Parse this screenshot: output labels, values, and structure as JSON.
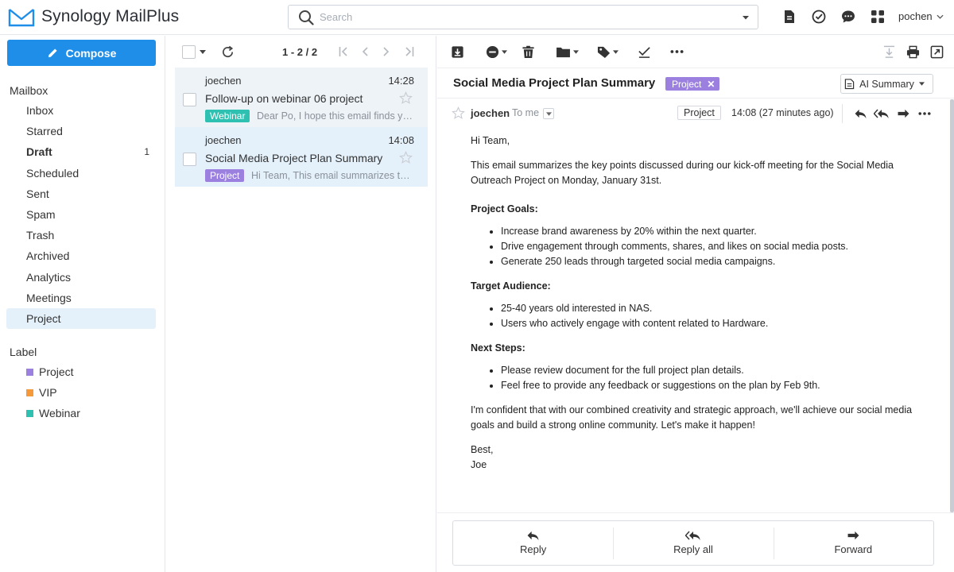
{
  "app": {
    "title": "Synology MailPlus"
  },
  "search": {
    "placeholder": "Search"
  },
  "header": {
    "user": "pochen"
  },
  "colors": {
    "accent": "#1f8ee8",
    "project": "#9b80e0",
    "vip": "#f59a3a",
    "webinar": "#2ec1b1",
    "selected_bg": "#e4f1fb"
  },
  "sidebar": {
    "compose_label": "Compose",
    "mailbox_title": "Mailbox",
    "items": [
      {
        "label": "Inbox"
      },
      {
        "label": "Starred"
      },
      {
        "label": "Draft",
        "count": "1"
      },
      {
        "label": "Scheduled"
      },
      {
        "label": "Sent"
      },
      {
        "label": "Spam"
      },
      {
        "label": "Trash"
      },
      {
        "label": "Archived"
      },
      {
        "label": "Analytics"
      },
      {
        "label": "Meetings"
      },
      {
        "label": "Project"
      }
    ],
    "label_title": "Label",
    "labels": [
      {
        "label": "Project"
      },
      {
        "label": "VIP"
      },
      {
        "label": "Webinar"
      }
    ]
  },
  "list": {
    "pager": "1 - 2 / 2",
    "mails": [
      {
        "from": "joechen",
        "time": "14:28",
        "subject": "Follow-up on webinar 06 project",
        "tag": "Webinar",
        "preview": "Dear Po, I hope this email finds you well."
      },
      {
        "from": "joechen",
        "time": "14:08",
        "subject": "Social Media Project Plan Summary",
        "tag": "Project",
        "preview": "Hi Team, This email summarizes the key points"
      }
    ]
  },
  "reader": {
    "subject": "Social Media Project Plan Summary",
    "subject_tag": "Project",
    "ai_summary": "AI Summary",
    "sender": "joechen",
    "to": "To me",
    "sender_tag": "Project",
    "time": "14:08 (27 minutes ago)",
    "body": {
      "greeting": "Hi Team,",
      "intro": "This email summarizes the key points discussed during our kick-off meeting for the Social Media Outreach Project on Monday, January 31st.",
      "goals_title": "Project Goals:",
      "goals": [
        "Increase brand awareness by 20% within the next quarter.",
        "Drive engagement through comments, shares, and likes on social media posts.",
        "Generate 250 leads through targeted social media campaigns."
      ],
      "audience_title": "Target Audience:",
      "audience": [
        "25-40 years old interested in NAS.",
        "Users who actively engage with content related to Hardware."
      ],
      "steps_title": "Next Steps:",
      "steps": [
        "Please review document for the full project plan details.",
        "Feel free to provide any feedback or suggestions on the plan by Feb 9th."
      ],
      "closing": "I'm confident that with our combined creativity and strategic approach, we'll achieve our social media goals and build a strong online community. Let's make it happen!",
      "signoff": "Best,",
      "signature": "Joe"
    },
    "actions": {
      "reply": "Reply",
      "reply_all": "Reply all",
      "forward": "Forward"
    }
  }
}
